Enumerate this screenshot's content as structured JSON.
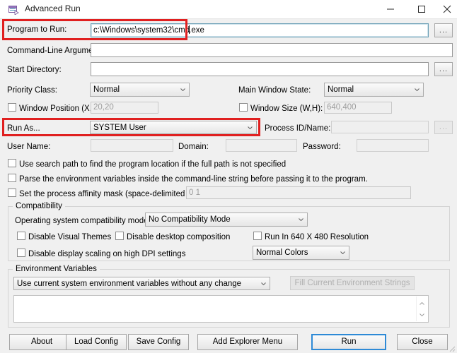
{
  "window": {
    "title": "Advanced Run",
    "icon": "app-window-icon",
    "controls": {
      "minimize": "minimize-icon",
      "maximize": "maximize-icon",
      "close": "close-icon"
    }
  },
  "highlight_color": "#e02020",
  "form": {
    "program_to_run": {
      "label": "Program to Run:",
      "value": "c:\\Windows\\system32\\cmd.exe",
      "value_before_caret": "c:\\Windows\\system32\\cmd",
      "value_after_caret": ".exe",
      "browse_label": "...",
      "highlighted": true
    },
    "command_line_arguments": {
      "label": "Command-Line Arguments:",
      "value": "",
      "placeholder": ""
    },
    "start_directory": {
      "label": "Start Directory:",
      "value": "",
      "browse_label": "..."
    },
    "priority_class": {
      "label": "Priority Class:",
      "value": "Normal"
    },
    "main_window_state": {
      "label": "Main Window State:",
      "value": "Normal"
    },
    "window_position": {
      "label": "Window Position (X,Y):",
      "checked": false,
      "value": "20,20"
    },
    "window_size": {
      "label": "Window Size (W,H):",
      "checked": false,
      "value": "640,400"
    },
    "run_as": {
      "label": "Run As...",
      "value": "SYSTEM User",
      "highlighted": true
    },
    "process_id_name": {
      "label": "Process ID/Name:",
      "value": "",
      "browse_label": "..."
    },
    "user_name": {
      "label": "User Name:",
      "value": ""
    },
    "domain": {
      "label": "Domain:",
      "value": ""
    },
    "password": {
      "label": "Password:",
      "value": ""
    },
    "use_search_path": {
      "label": "Use search path to find the program location if the full path is not specified",
      "checked": false
    },
    "parse_env_vars": {
      "label": "Parse the environment variables inside the command-line string before passing it to the program.",
      "checked": false
    },
    "affinity_mask": {
      "label": "Set the process affinity mask (space-delimited list):",
      "checked": false,
      "value": "0 1"
    }
  },
  "compatibility": {
    "title": "Compatibility",
    "os_mode": {
      "label": "Operating system compatibility mode:",
      "value": "No Compatibility Mode"
    },
    "disable_visual_themes": {
      "label": "Disable Visual Themes",
      "checked": false
    },
    "disable_desktop_composition": {
      "label": "Disable desktop composition",
      "checked": false
    },
    "run_640x480": {
      "label": "Run In 640 X 480 Resolution",
      "checked": false
    },
    "disable_dpi_scaling": {
      "label": "Disable display scaling on high DPI settings",
      "checked": false
    },
    "colors": {
      "value": "Normal Colors"
    }
  },
  "environment": {
    "title": "Environment Variables",
    "mode": {
      "value": "Use current system environment variables without any change"
    },
    "fill_button": {
      "label": "Fill Current Environment Strings",
      "disabled": true
    },
    "textarea": {
      "value": ""
    }
  },
  "footer": {
    "about": "About",
    "load_config": "Load Config",
    "save_config": "Save Config",
    "add_explorer_menu": "Add Explorer Menu",
    "run": "Run",
    "close": "Close"
  }
}
